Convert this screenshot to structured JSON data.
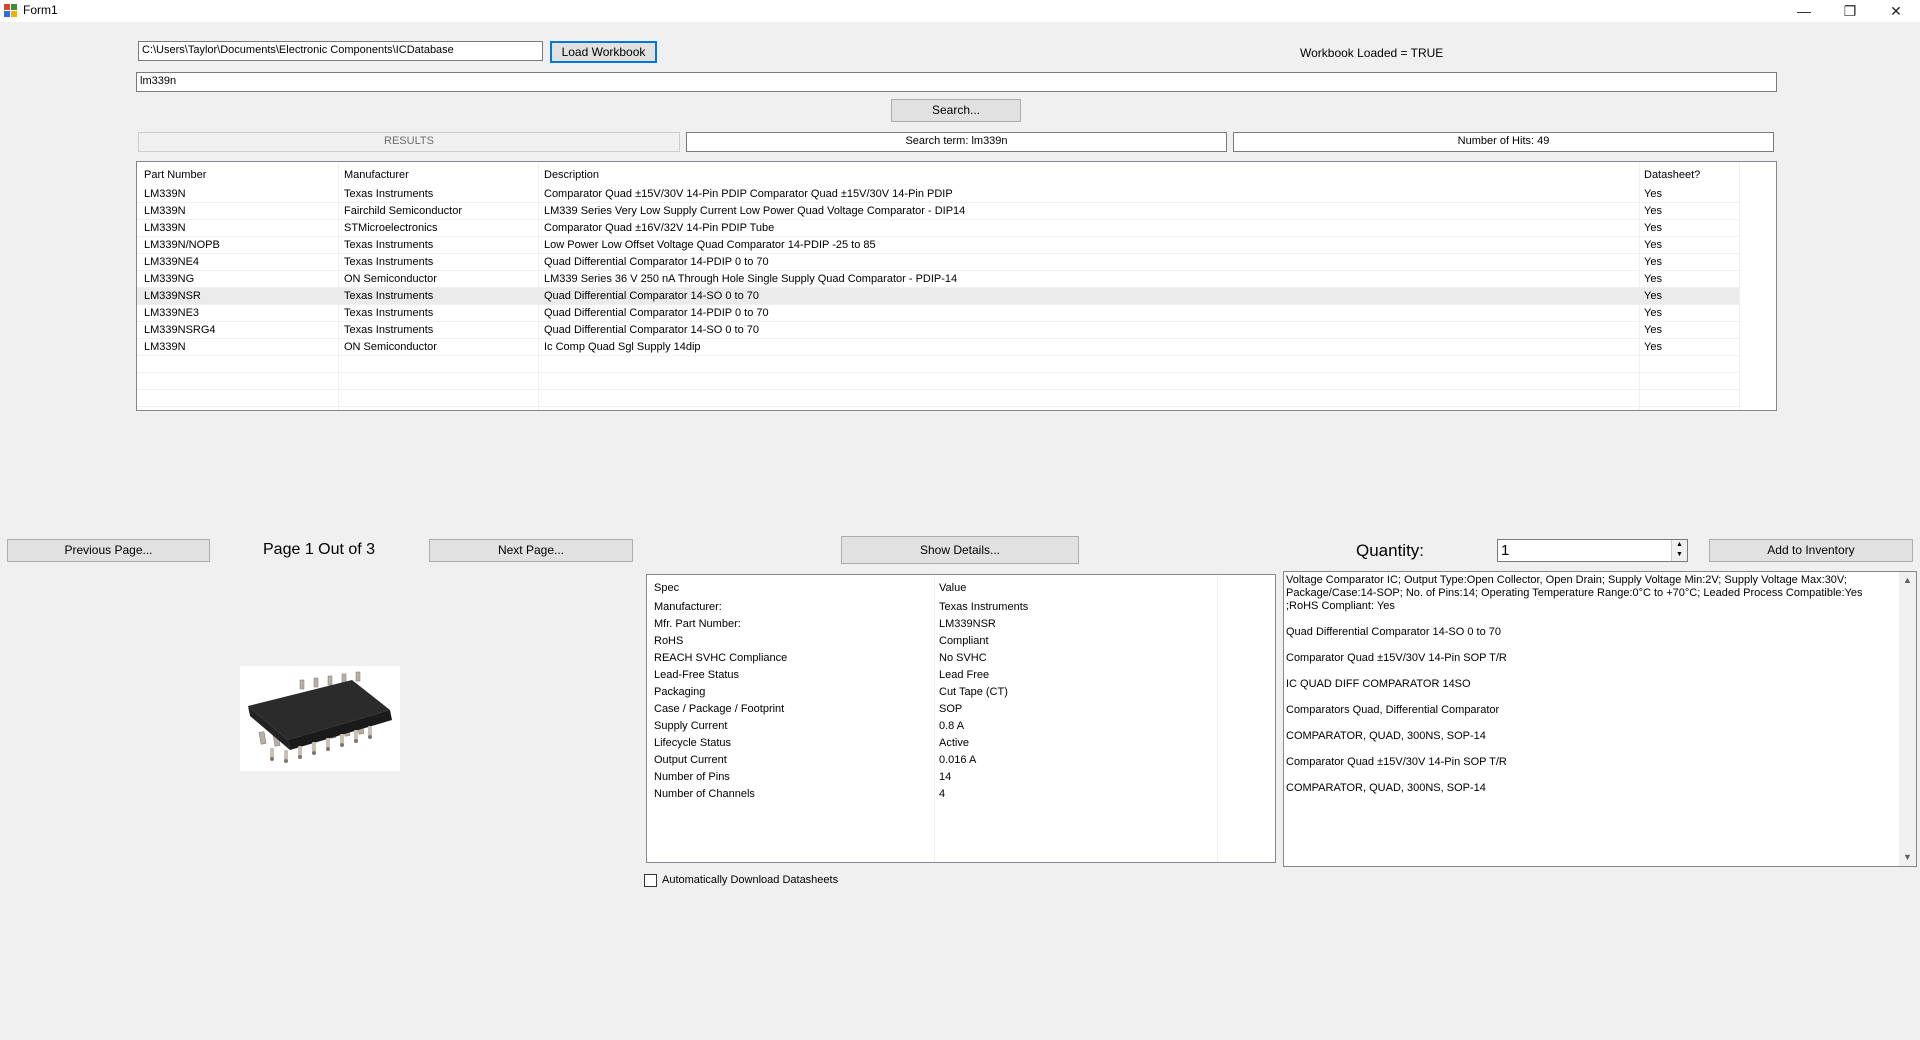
{
  "window": {
    "title": "Form1",
    "controls": {
      "minimize": "—",
      "restore": "❐",
      "close": "✕"
    }
  },
  "workbook": {
    "path": "C:\\Users\\Taylor\\Documents\\Electronic Components\\ICDatabase",
    "load_label": "Load Workbook",
    "status": "Workbook Loaded = TRUE"
  },
  "search": {
    "query": "lm339n",
    "button_label": "Search..."
  },
  "results_header": {
    "results_label": "RESULTS",
    "search_term": "Search term: lm339n",
    "hits": "Number of Hits: 49"
  },
  "grid": {
    "columns": [
      "Part Number",
      "Manufacturer",
      "Description",
      "Datasheet?"
    ],
    "rows": [
      [
        "LM339N",
        "Texas Instruments",
        "Comparator Quad ±15V/30V 14-Pin PDIP Comparator Quad ±15V/30V 14-Pin PDIP",
        "Yes"
      ],
      [
        "LM339N",
        "Fairchild Semiconductor",
        "LM339 Series Very Low Supply Current Low Power Quad Voltage Comparator - DIP14",
        "Yes"
      ],
      [
        "LM339N",
        "STMicroelectronics",
        "Comparator Quad ±16V/32V 14-Pin PDIP Tube",
        "Yes"
      ],
      [
        "LM339N/NOPB",
        "Texas Instruments",
        "Low Power Low Offset Voltage Quad Comparator 14-PDIP -25 to 85",
        "Yes"
      ],
      [
        "LM339NE4",
        "Texas Instruments",
        "Quad Differential Comparator 14-PDIP 0 to 70",
        "Yes"
      ],
      [
        "LM339NG",
        "ON Semiconductor",
        "LM339 Series 36 V 250 nA Through Hole Single Supply Quad Comparator - PDIP-14",
        "Yes"
      ],
      [
        "LM339NSR",
        "Texas Instruments",
        "Quad Differential Comparator 14-SO 0 to 70",
        "Yes"
      ],
      [
        "LM339NE3",
        "Texas Instruments",
        "Quad Differential Comparator 14-PDIP 0 to 70",
        "Yes"
      ],
      [
        "LM339NSRG4",
        "Texas Instruments",
        "Quad Differential Comparator 14-SO 0 to 70",
        "Yes"
      ],
      [
        "LM339N",
        "ON Semiconductor",
        "Ic Comp Quad Sgl Supply 14dip",
        "Yes"
      ]
    ],
    "selected_index": 6
  },
  "paging": {
    "previous_label": "Previous Page...",
    "page_text": "Page 1 Out of 3",
    "next_label": "Next Page..."
  },
  "details": {
    "show_label": "Show Details...",
    "quantity_label": "Quantity:",
    "quantity_value": "1",
    "add_label": "Add to Inventory"
  },
  "spec": {
    "columns": [
      "Spec",
      "Value"
    ],
    "rows": [
      [
        "Manufacturer:",
        "Texas Instruments"
      ],
      [
        "Mfr. Part Number:",
        "LM339NSR"
      ],
      [
        "RoHS",
        "Compliant"
      ],
      [
        "REACH SVHC Compliance",
        "No SVHC"
      ],
      [
        "Lead-Free Status",
        "Lead Free"
      ],
      [
        "Packaging",
        "Cut Tape (CT)"
      ],
      [
        "Case / Package / Footprint",
        "SOP"
      ],
      [
        "Supply Current",
        "0.8 A"
      ],
      [
        "Lifecycle Status",
        "Active"
      ],
      [
        "Output Current",
        "0.016 A"
      ],
      [
        "Number of Pins",
        "14"
      ],
      [
        "Number of Channels",
        "4"
      ]
    ]
  },
  "descriptions": [
    "Voltage Comparator IC; Output Type:Open Collector, Open Drain; Supply Voltage Min:2V; Supply Voltage Max:30V; Package/Case:14-SOP; No. of Pins:14; Operating Temperature Range:0°C to +70°C; Leaded Process Compatible:Yes ;RoHS Compliant: Yes",
    "Quad Differential Comparator 14-SO 0 to 70",
    "Comparator Quad ±15V/30V 14-Pin SOP T/R",
    "IC QUAD DIFF COMPARATOR 14SO",
    "Comparators  Quad, Differential Comparator",
    "COMPARATOR, QUAD, 300NS, SOP-14",
    "Comparator Quad ±15V/30V 14-Pin SOP T/R",
    "COMPARATOR, QUAD, 300NS, SOP-14"
  ],
  "auto_download": {
    "label": "Automatically Download Datasheets",
    "checked": false
  },
  "colors": {
    "background": "#f0f0f0",
    "focus_accent": "#0078d7",
    "selected_row": "#ebebeb"
  }
}
